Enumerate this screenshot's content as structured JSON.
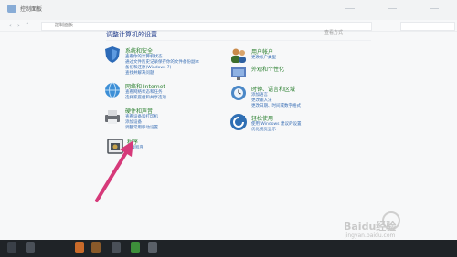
{
  "window": {
    "title": "控制面板"
  },
  "address": {
    "text": "控制面板"
  },
  "heading": "调整计算机的设置",
  "view": {
    "label": "查看方式"
  },
  "categories_left": [
    {
      "id": "system",
      "title": "系统和安全",
      "links": [
        "查看你的计算机状态",
        "通过文件历史记录保存你的文件备份副本",
        "备份和还原(Windows 7)",
        "查找并解决问题"
      ],
      "icon": "shield-icon",
      "color": "#2d6bb8"
    },
    {
      "id": "network",
      "title": "网络和 Internet",
      "links": [
        "查看网络状态和任务",
        "选择家庭组和共享选项"
      ],
      "icon": "globe-icon",
      "color": "#3d8fd6"
    },
    {
      "id": "hardware",
      "title": "硬件和声音",
      "links": [
        "查看设备和打印机",
        "添加设备",
        "调整常用移动设置"
      ],
      "icon": "printer-icon",
      "color": "#6b6f75"
    },
    {
      "id": "programs",
      "title": "程序",
      "links": [
        "卸载程序"
      ],
      "icon": "programs-icon",
      "color": "#4a5057"
    }
  ],
  "categories_right": [
    {
      "id": "accounts",
      "title": "用户帐户",
      "links": [
        "更改帐户类型"
      ],
      "icon": "users-icon",
      "color": "#3d6e2c"
    },
    {
      "id": "appearance",
      "title": "外观和个性化",
      "links": [],
      "icon": "appearance-icon",
      "color": "#5a7fbf"
    },
    {
      "id": "clock",
      "title": "时钟、语言和区域",
      "links": [
        "添加语言",
        "更改输入法",
        "更改日期、时间或数字格式"
      ],
      "icon": "clock-globe-icon",
      "color": "#4b88c7"
    },
    {
      "id": "ease",
      "title": "轻松使用",
      "links": [
        "使用 Windows 建议的设置",
        "优化视觉显示"
      ],
      "icon": "ease-icon",
      "color": "#2f6fb4"
    }
  ],
  "annotation": {
    "color": "#d63a7a"
  },
  "watermark": {
    "text": "Baidu经验",
    "sub": "jingyan.baidu.com"
  }
}
